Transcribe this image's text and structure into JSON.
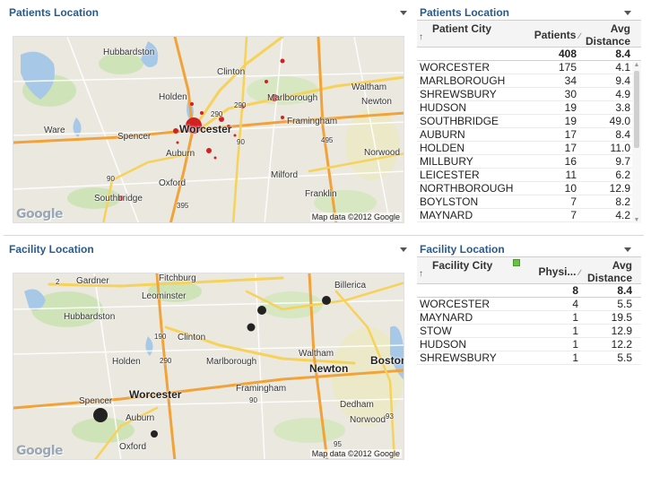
{
  "patients_map": {
    "title": "Patients Location",
    "attribution": "Map data ©2012 Google",
    "logo": "Google",
    "places": [
      "Hubbardston",
      "Clinton",
      "Holden",
      "Marlborough",
      "Waltham",
      "Newton",
      "Ware",
      "Worcester",
      "Framingham",
      "Spencer",
      "Auburn",
      "Oxford",
      "Milford",
      "Franklin",
      "Southbridge",
      "Norwood",
      "290",
      "290",
      "90",
      "90",
      "495",
      "395"
    ]
  },
  "patients_table": {
    "title": "Patients Location",
    "headers": {
      "city": "Patient City",
      "count": "Patients",
      "distance": "Avg Distance"
    },
    "totals": {
      "count": "408",
      "distance": "8.4"
    },
    "rows": [
      {
        "city": "WORCESTER",
        "count": "175",
        "distance": "4.1"
      },
      {
        "city": "MARLBOROUGH",
        "count": "34",
        "distance": "9.4"
      },
      {
        "city": "SHREWSBURY",
        "count": "30",
        "distance": "4.9"
      },
      {
        "city": "HUDSON",
        "count": "19",
        "distance": "3.8"
      },
      {
        "city": "SOUTHBRIDGE",
        "count": "19",
        "distance": "49.0"
      },
      {
        "city": "AUBURN",
        "count": "17",
        "distance": "8.4"
      },
      {
        "city": "HOLDEN",
        "count": "17",
        "distance": "11.0"
      },
      {
        "city": "MILLBURY",
        "count": "16",
        "distance": "9.7"
      },
      {
        "city": "LEICESTER",
        "count": "11",
        "distance": "6.2"
      },
      {
        "city": "NORTHBOROUGH",
        "count": "10",
        "distance": "12.9"
      },
      {
        "city": "BOYLSTON",
        "count": "7",
        "distance": "8.2"
      },
      {
        "city": "MAYNARD",
        "count": "7",
        "distance": "4.2"
      }
    ]
  },
  "facility_map": {
    "title": "Facility Location",
    "attribution": "Map data ©2012 Google",
    "logo": "Google",
    "places": [
      "Gardner",
      "Fitchburg",
      "Leominster",
      "Billerica",
      "Hubbardston",
      "Clinton",
      "Holden",
      "Marlborough",
      "Waltham",
      "Newton",
      "Boston",
      "Worcester",
      "Framingham",
      "Spencer",
      "Auburn",
      "Dedham",
      "Norwood",
      "Oxford",
      "2",
      "190",
      "290",
      "90",
      "95",
      "93"
    ]
  },
  "facility_table": {
    "title": "Facility Location",
    "headers": {
      "city": "Facility City",
      "count": "Physi...",
      "distance": "Avg Distance"
    },
    "totals": {
      "count": "8",
      "distance": "8.4"
    },
    "rows": [
      {
        "city": "WORCESTER",
        "count": "4",
        "distance": "5.5"
      },
      {
        "city": "MAYNARD",
        "count": "1",
        "distance": "19.5"
      },
      {
        "city": "STOW",
        "count": "1",
        "distance": "12.9"
      },
      {
        "city": "HUDSON",
        "count": "1",
        "distance": "12.2"
      },
      {
        "city": "SHREWSBURY",
        "count": "1",
        "distance": "5.5"
      }
    ]
  },
  "colors": {
    "title": "#2a5a8a",
    "patient_marker": "#d42020",
    "facility_marker": "#222222",
    "highway_yellow": "#f7d25a",
    "highway_orange": "#f1a33a",
    "water": "#a8c8e8",
    "park": "#c8dfb0"
  }
}
